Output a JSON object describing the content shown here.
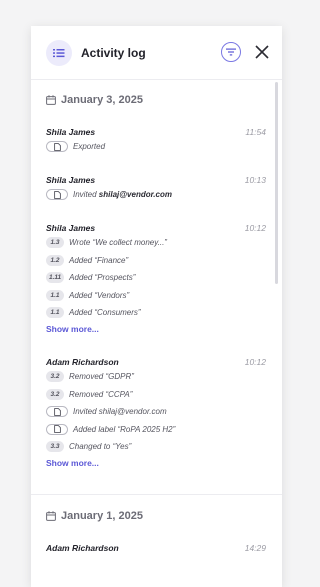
{
  "header": {
    "title": "Activity log",
    "list_icon": "list-icon",
    "filter_icon": "filter-icon",
    "close_icon": "close-icon"
  },
  "colors": {
    "accent": "#5b58d6",
    "badge_bg": "#e6e6eb",
    "muted": "#9a9aa3"
  },
  "days": [
    {
      "date": "January 3, 2025",
      "entries": [
        {
          "author": "Shila James",
          "time": "11:54",
          "actions": [
            {
              "badge": "",
              "icon": "document-icon",
              "text": "Exported"
            }
          ]
        },
        {
          "author": "Shila James",
          "time": "10:13",
          "actions": [
            {
              "badge": "",
              "icon": "document-icon",
              "text": "Invited ",
              "bold": "shilaj@vendor.com"
            }
          ]
        },
        {
          "author": "Shila James",
          "time": "10:12",
          "actions": [
            {
              "badge": "1.3",
              "text": "Wrote “We collect money...”"
            },
            {
              "badge": "1.2",
              "text": "Added “Finance”"
            },
            {
              "badge": "1.11",
              "text": "Added “Prospects”"
            },
            {
              "badge": "1.1",
              "text": "Added “Vendors”"
            },
            {
              "badge": "1.1",
              "text": "Added “Consumers”"
            }
          ],
          "show_more": "Show more..."
        },
        {
          "author": "Adam Richardson",
          "time": "10:12",
          "actions": [
            {
              "badge": "3.2",
              "text": "Removed “GDPR”"
            },
            {
              "badge": "3.2",
              "text": "Removed “CCPA”"
            },
            {
              "badge": "",
              "icon": "document-icon",
              "text": "Invited shilaj@vendor.com"
            },
            {
              "badge": "",
              "icon": "document-icon",
              "text": "Added label “RoPA 2025 H2”"
            },
            {
              "badge": "3.3",
              "text": "Changed to “Yes”"
            }
          ],
          "show_more": "Show more..."
        }
      ]
    },
    {
      "date": "January 1, 2025",
      "entries": [
        {
          "author": "Adam Richardson",
          "time": "14:29",
          "actions": []
        }
      ]
    }
  ]
}
